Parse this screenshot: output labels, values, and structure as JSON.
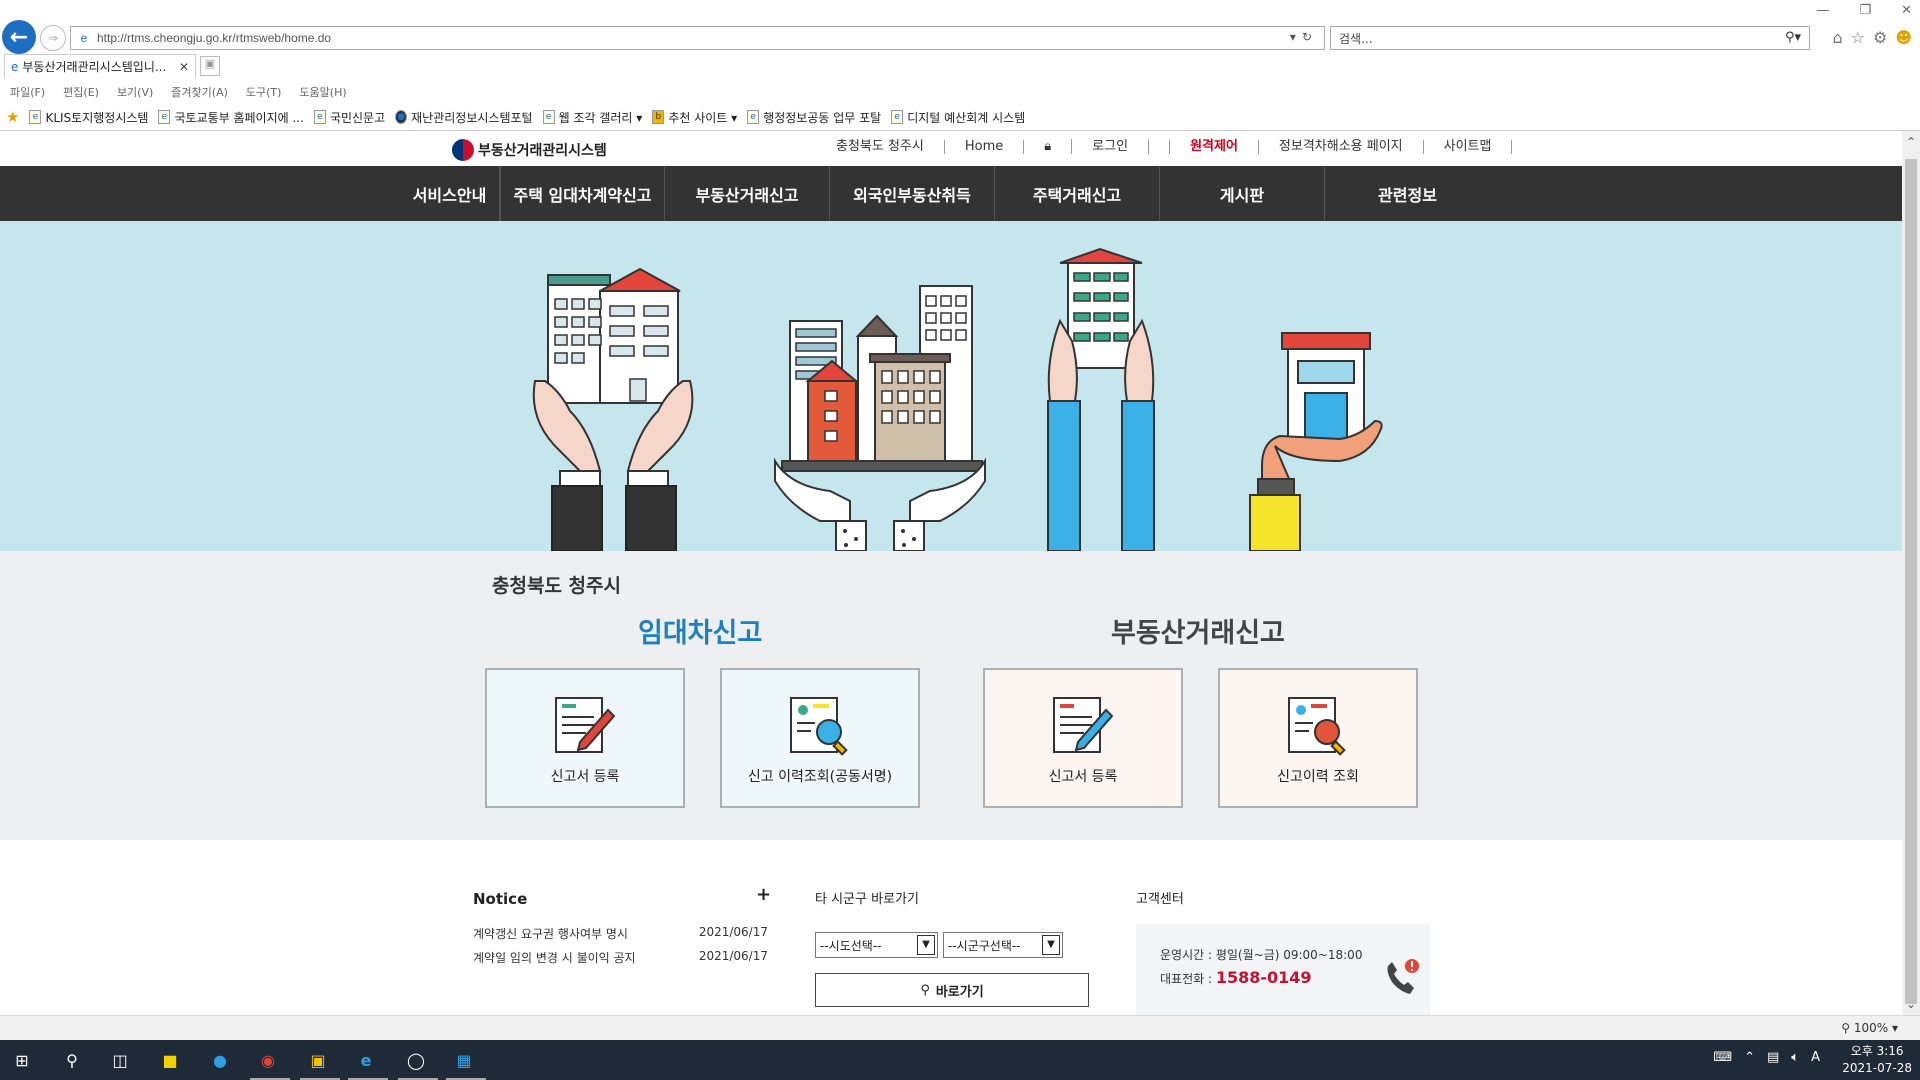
{
  "browser": {
    "url": "http://rtms.cheongju.go.kr/rtmsweb/home.do",
    "search_placeholder": "검색...",
    "tab_title": "부동산거래관리시스템입니...",
    "menu": [
      "파일(F)",
      "편집(E)",
      "보기(V)",
      "즐겨찾기(A)",
      "도구(T)",
      "도움말(H)"
    ],
    "favorites": [
      "KLIS토지행정시스템",
      "국토교통부 홈페이지에 ...",
      "국민신문고",
      "재난관리정보시스템포털",
      "웹 조각 갤러리 ▾",
      "추천 사이트 ▾",
      "행정정보공동 업무 포탈",
      "디지털 예산회계 시스템"
    ],
    "zoom": "100%"
  },
  "site": {
    "logo_text": "부동산거래관리시스템",
    "util_nav": [
      "충청북도 청주시",
      "Home",
      "로그인",
      "원격제어",
      "정보격차해소용 페이지",
      "사이트맵"
    ],
    "gnb": [
      "서비스안내",
      "주택 임대차계약신고",
      "부동산거래신고",
      "외국인부동산취득",
      "주택거래신고",
      "게시판",
      "관련정보"
    ],
    "region": "충청북도 청주시",
    "lease": {
      "title": "임대차신고",
      "btn1": "신고서 등록",
      "btn2": "신고 이력조회(공동서명)"
    },
    "trade": {
      "title": "부동산거래신고",
      "btn1": "신고서 등록",
      "btn2": "신고이력 조회"
    },
    "notice": {
      "title": "Notice",
      "plus": "+",
      "rows": [
        {
          "text": "계약갱신 요구권 행사여부 명시",
          "date": "2021/06/17"
        },
        {
          "text": "계약일 임의 변경 시 불이익 공지",
          "date": "2021/06/17"
        }
      ]
    },
    "shortcut": {
      "title": "타 시군구 바로가기",
      "sido": "--시도선택--",
      "sigungu": "--시군구선택--",
      "go": "바로가기"
    },
    "cs": {
      "title": "고객센터",
      "hours_label": "운영시간 : ",
      "hours": "평일(월~금) 09:00~18:00",
      "phone_label": "대표전화 : ",
      "phone": "1588-0149"
    }
  },
  "taskbar": {
    "time": "오후 3:16",
    "date": "2021-07-28",
    "ime": "A"
  },
  "colors": {
    "gnb_bg": "#333333",
    "hero_bg": "#c6e6ee",
    "lease_title": "#1a7fc4",
    "trade_title": "#444444",
    "remote_red": "#d6001c",
    "phone_red": "#c8102e"
  }
}
